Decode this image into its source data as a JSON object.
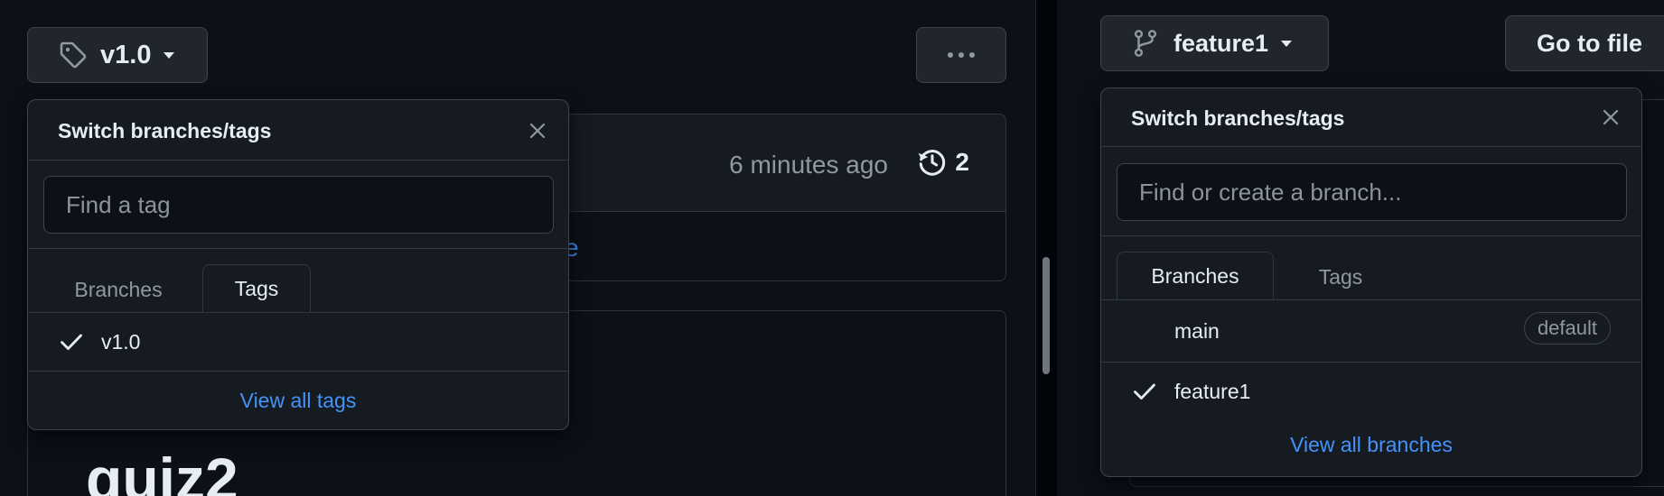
{
  "left": {
    "tag_button": {
      "label": "v1.0",
      "icon": "tag-icon"
    },
    "more_button": {
      "icon": "kebab-horizontal-icon"
    },
    "commit": {
      "time": "6 minutes ago",
      "history_count": "2"
    },
    "partial_link": "e",
    "readme_heading": "quiz2",
    "dropdown": {
      "title": "Switch branches/tags",
      "search_placeholder": "Find a tag",
      "tabs": [
        "Branches",
        "Tags"
      ],
      "active_tab": "Tags",
      "items": [
        {
          "label": "v1.0",
          "selected": true
        }
      ],
      "view_all": "View all tags"
    }
  },
  "right": {
    "branch_button": {
      "label": "feature1",
      "icon": "git-branch-icon"
    },
    "goto_file_button": {
      "label": "Go to file"
    },
    "dropdown": {
      "title": "Switch branches/tags",
      "search_placeholder": "Find or create a branch...",
      "tabs": [
        "Branches",
        "Tags"
      ],
      "active_tab": "Branches",
      "items": [
        {
          "label": "main",
          "selected": false,
          "badge": "default"
        },
        {
          "label": "feature1",
          "selected": true
        }
      ],
      "view_all": "View all branches"
    }
  },
  "colors": {
    "accent": "#4493f8",
    "background": "#0d1117",
    "overlay": "#161b22",
    "border": "#3d444d"
  }
}
